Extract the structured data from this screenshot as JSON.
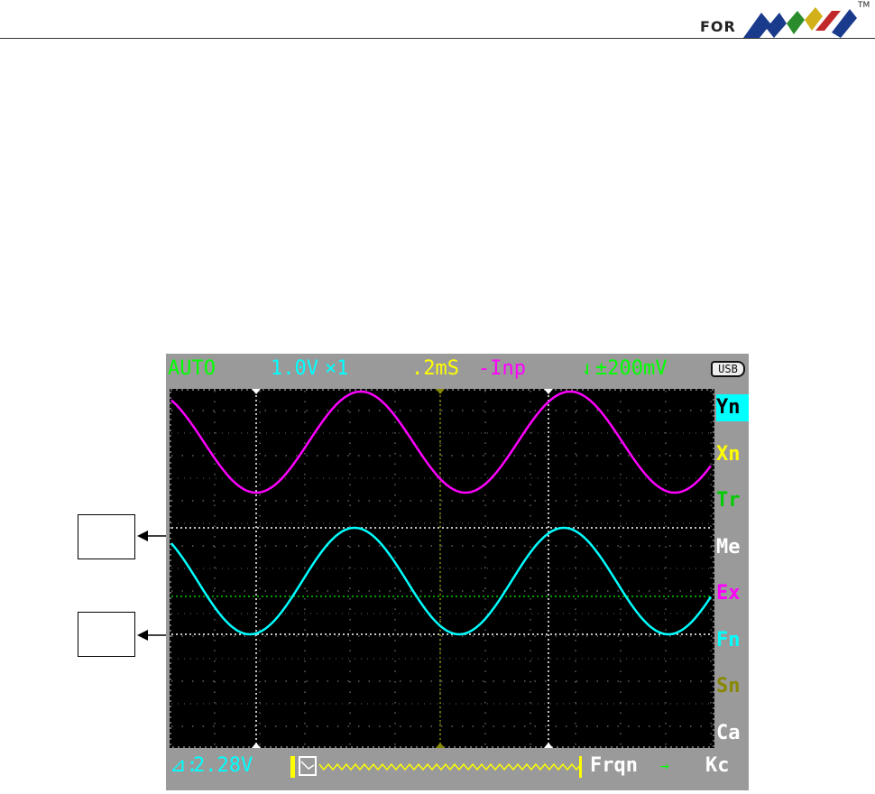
{
  "header": {
    "for_text": "FOR",
    "tm": "TM"
  },
  "status_bar": {
    "mode": "AUTO",
    "volt_div": "1.0V",
    "probe": "×1",
    "time_div": ".2mS",
    "trigger_source": "-Inp",
    "trigger_level": "±200mV",
    "usb": "USB"
  },
  "menu": {
    "items": [
      "Yn",
      "Xn",
      "Tr",
      "Me",
      "Ex",
      "Fn",
      "Sn",
      "Ca"
    ],
    "colors": [
      "#000000",
      "#ffff00",
      "#00cc00",
      "#ffffff",
      "#ff00ff",
      "#00ffff",
      "#888800",
      "#ffffff"
    ],
    "selected_index": 0,
    "selected_bg": "#00ffff"
  },
  "bottom_bar": {
    "delta": "2.28V",
    "frequency_label": "Frqn",
    "units": "Kc"
  },
  "colors": {
    "ch_a": "#ff00ff",
    "ch_b": "#00ffff",
    "trigger": "#00cc00",
    "auto": "#00ff00",
    "volt": "#00ffff",
    "time": "#ffff00",
    "bezel": "#9a9a9a",
    "grid": "#888888"
  }
}
